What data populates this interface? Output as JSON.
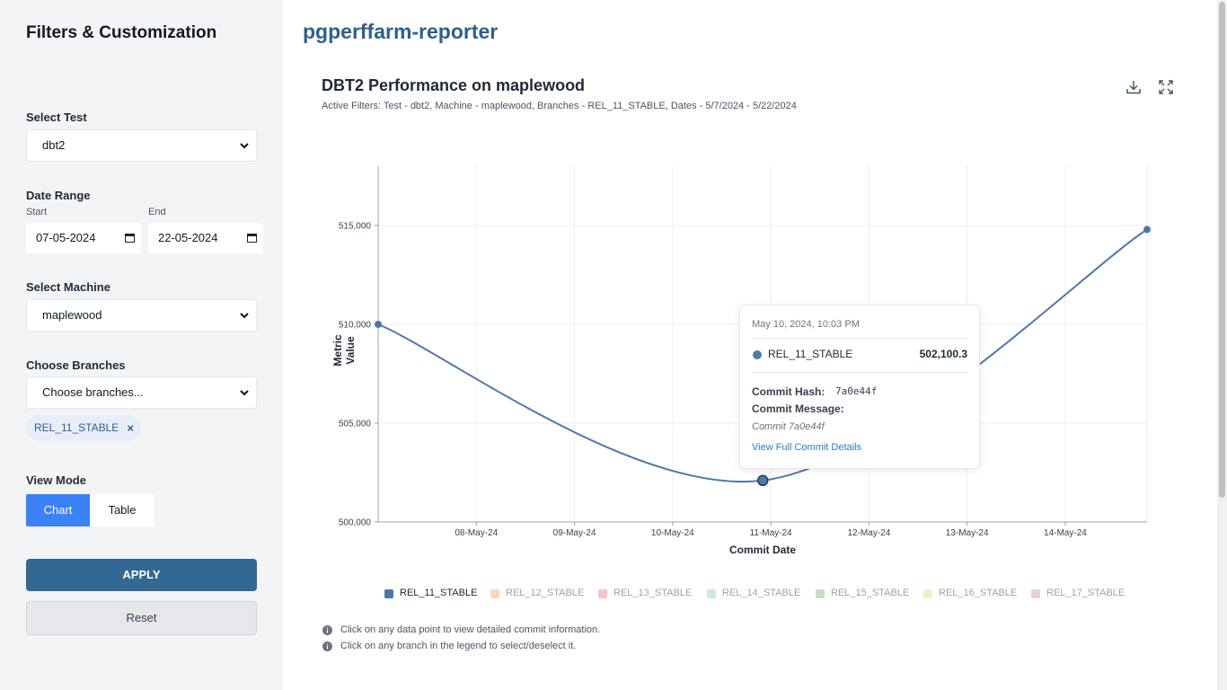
{
  "sidebar": {
    "title": "Filters & Customization",
    "test_label": "Select Test",
    "test_value": "dbt2",
    "date_range_label": "Date Range",
    "start_label": "Start",
    "end_label": "End",
    "start_value": "07-05-2024",
    "end_value": "22-05-2024",
    "machine_label": "Select Machine",
    "machine_value": "maplewood",
    "branches_label": "Choose Branches",
    "branches_placeholder": "Choose branches...",
    "selected_branches": [
      "REL_11_STABLE"
    ],
    "view_mode_label": "View Mode",
    "view_mode_options": [
      "Chart",
      "Table"
    ],
    "view_mode_active": "Chart",
    "apply_label": "APPLY",
    "reset_label": "Reset"
  },
  "header": {
    "app_title": "pgperffarm-reporter"
  },
  "chart_header": {
    "title": "DBT2 Performance on maplewood",
    "subtitle": "Active Filters: Test - dbt2, Machine - maplewood, Branches - REL_11_STABLE, Dates - 5/7/2024 - 5/22/2024",
    "download_icon": "download-icon",
    "fullscreen_icon": "fullscreen-icon"
  },
  "chart_data": {
    "type": "line",
    "xlabel": "Commit Date",
    "ylabel": "Metric Value",
    "x_ticks": [
      "08-May-24",
      "09-May-24",
      "10-May-24",
      "11-May-24",
      "12-May-24",
      "13-May-24",
      "14-May-24"
    ],
    "y_ticks": [
      "500,000",
      "505,000",
      "510,000",
      "515,000"
    ],
    "ylim": [
      500000,
      518000
    ],
    "xlim": [
      "2024-05-07",
      "2024-05-14T20:00"
    ],
    "grid": true,
    "series": [
      {
        "name": "REL_11_STABLE",
        "color": "#4e79a7",
        "points": [
          {
            "x": "2024-05-07",
            "y": 510000
          },
          {
            "x": "2024-05-10T22:03",
            "y": 502100.3
          },
          {
            "x": "2024-05-14T20:00",
            "y": 514800
          }
        ]
      }
    ],
    "legend": [
      {
        "name": "REL_11_STABLE",
        "color": "#4e79a7",
        "active": true
      },
      {
        "name": "REL_12_STABLE",
        "color": "#f28e2b",
        "active": false
      },
      {
        "name": "REL_13_STABLE",
        "color": "#e15759",
        "active": false
      },
      {
        "name": "REL_14_STABLE",
        "color": "#76b7b2",
        "active": false
      },
      {
        "name": "REL_15_STABLE",
        "color": "#59a14f",
        "active": false
      },
      {
        "name": "REL_16_STABLE",
        "color": "#edc948",
        "active": false
      },
      {
        "name": "REL_17_STABLE",
        "color": "#b07aa1",
        "active": false
      }
    ]
  },
  "tooltip": {
    "date": "May 10, 2024, 10:03 PM",
    "branch": "REL_11_STABLE",
    "value": "502,100.3",
    "hash_label": "Commit Hash:",
    "hash_value": "7a0e44f",
    "message_label": "Commit Message:",
    "message_value": "Commit 7a0e44f",
    "link_label": "View Full Commit Details"
  },
  "hints": [
    "Click on any data point to view detailed commit information.",
    "Click on any branch in the legend to select/deselect it."
  ]
}
